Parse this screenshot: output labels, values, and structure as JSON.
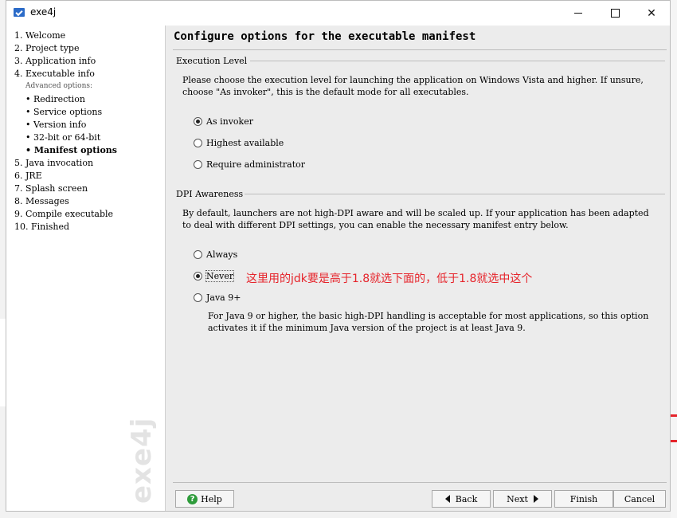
{
  "window": {
    "title": "exe4j"
  },
  "steps": [
    {
      "label": "1.  Welcome"
    },
    {
      "label": "2.  Project type"
    },
    {
      "label": "3.  Application info"
    },
    {
      "label": "4.  Executable info"
    },
    {
      "label": "Advanced options:"
    },
    {
      "label": "• Redirection"
    },
    {
      "label": "• Service options"
    },
    {
      "label": "• Version info"
    },
    {
      "label": "• 32-bit or 64-bit"
    },
    {
      "label": "• Manifest options"
    },
    {
      "label": "5.  Java invocation"
    },
    {
      "label": "6.  JRE"
    },
    {
      "label": "7.  Splash screen"
    },
    {
      "label": "8.  Messages"
    },
    {
      "label": "9.  Compile executable"
    },
    {
      "label": "10.  Finished"
    }
  ],
  "watermark": "exe4j",
  "page": {
    "title": "Configure options for the executable manifest"
  },
  "execution_level": {
    "label": "Execution Level",
    "description": "Please choose the execution level for launching the application on Windows Vista and higher. If unsure, choose \"As invoker\", this is the default mode for all executables.",
    "options": [
      {
        "label": "As invoker",
        "checked": true
      },
      {
        "label": "Highest available",
        "checked": false
      },
      {
        "label": "Require administrator",
        "checked": false
      }
    ]
  },
  "dpi_awareness": {
    "label": "DPI Awareness",
    "description": "By default, launchers are not high-DPI aware and will be scaled up. If your application has been adapted to deal with different DPI settings, you can enable the necessary manifest entry below.",
    "options": [
      {
        "label": "Always",
        "checked": false
      },
      {
        "label": "Never",
        "checked": true
      },
      {
        "label": "Java 9+",
        "checked": false
      }
    ],
    "java9_description": "For Java 9 or higher, the basic high-DPI handling is acceptable for most applications, so this option activates it if the minimum Java version of the project is at least Java 9."
  },
  "annotation": "这里用的jdk要是高于1.8就选下面的，低于1.8就选中这个",
  "buttons": {
    "help": "Help",
    "back": "Back",
    "next": "Next",
    "finish": "Finish",
    "cancel": "Cancel"
  },
  "colors": {
    "annotation": "#e6242b",
    "help_icon": "#2e9c3b"
  }
}
